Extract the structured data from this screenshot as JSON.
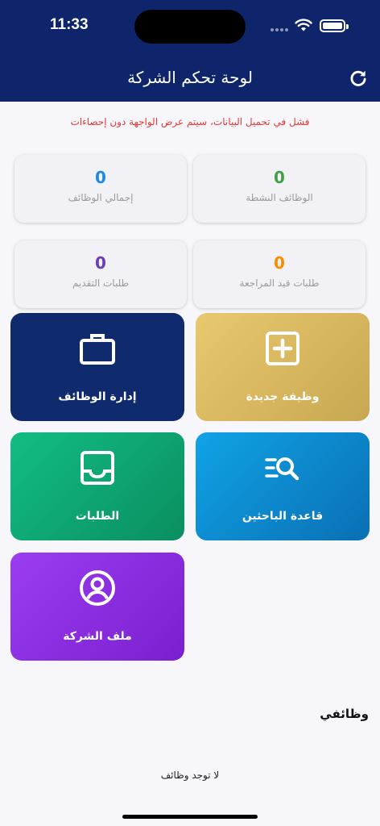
{
  "status_bar": {
    "time": "11:33"
  },
  "header": {
    "title": "لوحة تحكم الشركة"
  },
  "error_message": "فشل في تحميل البيانات، سيتم عرض الواجهة دون إحصاءات",
  "stats": [
    {
      "value": "0",
      "label": "الوظائف النشطة",
      "color": "#43a047"
    },
    {
      "value": "0",
      "label": "إجمالي الوظائف",
      "color": "#1e88e5"
    },
    {
      "value": "0",
      "label": "طلبات قيد المراجعة",
      "color": "#fb8c00"
    },
    {
      "value": "0",
      "label": "طلبات التقديم",
      "color": "#6a3db8"
    }
  ],
  "tiles": [
    {
      "label": "وظيفة جديدة",
      "icon": "plus-square-icon",
      "colors": [
        "#e9c96e",
        "#c8a752"
      ]
    },
    {
      "label": "إدارة الوظائف",
      "icon": "briefcase-icon",
      "colors": [
        "#102a6e",
        "#102a6e"
      ]
    },
    {
      "label": "قاعدة الباحثين",
      "icon": "search-list-icon",
      "colors": [
        "#10a3e6",
        "#0a6fb4"
      ]
    },
    {
      "label": "الطلبات",
      "icon": "inbox-icon",
      "colors": [
        "#12bd84",
        "#0a8e60"
      ]
    },
    {
      "label": "ملف الشركة",
      "icon": "user-circle-icon",
      "colors": [
        "#9b3cf0",
        "#7a1fd0"
      ]
    }
  ],
  "jobs_section": {
    "title": "وظائفي",
    "empty_text": "لا توجد وظائف"
  }
}
